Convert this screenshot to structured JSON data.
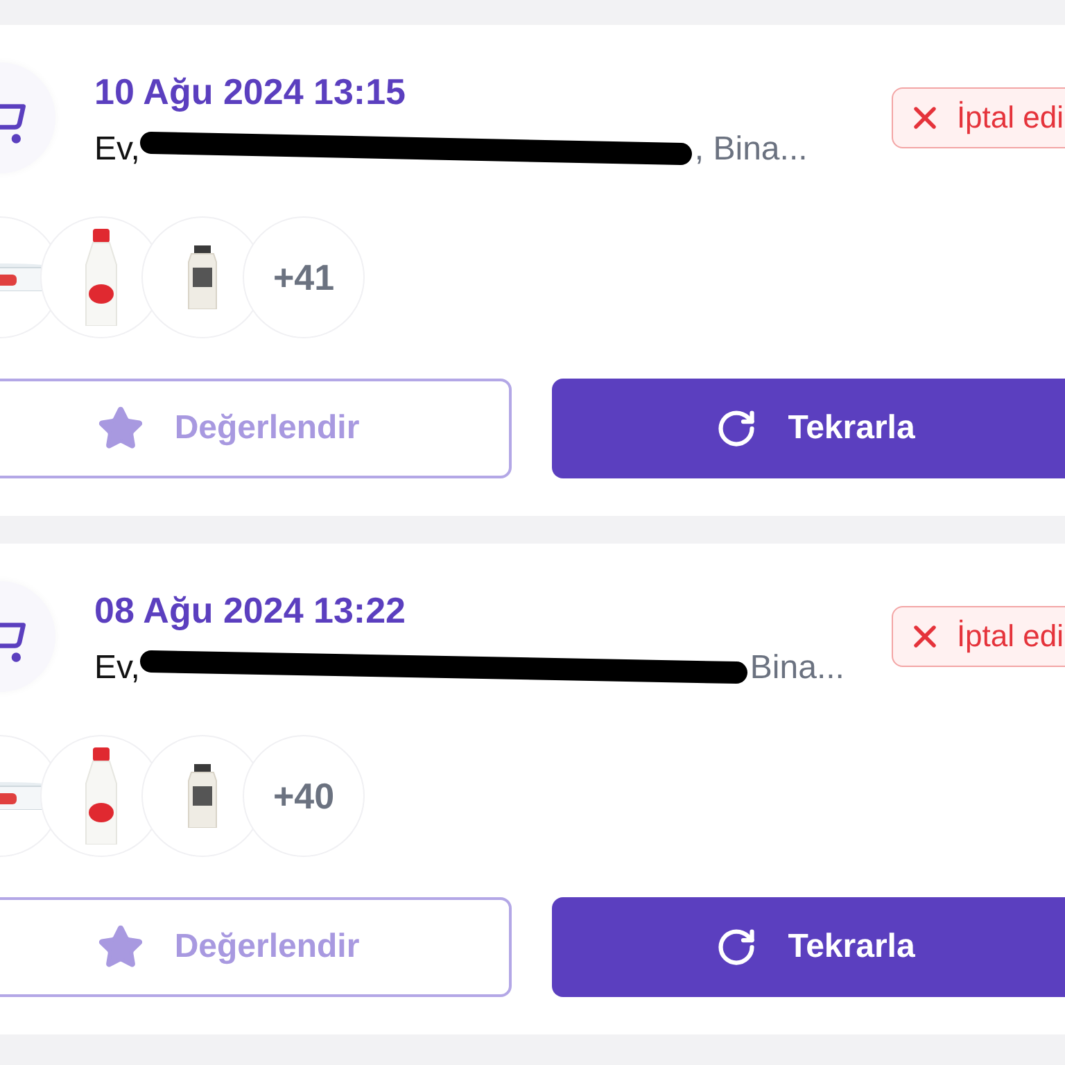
{
  "orders": [
    {
      "date": "10 Ağu 2024 13:15",
      "address_label": "Ev,",
      "address_tail": ", Bina...",
      "status": {
        "kind": "cancelled",
        "label": "İptal edi"
      },
      "products": [
        {
          "kind": "picture"
        },
        {
          "kind": "picture"
        },
        {
          "kind": "picture"
        }
      ],
      "more_count": "+41",
      "buttons": [
        {
          "kind": "rate",
          "label": "Değerlendir"
        },
        {
          "kind": "reorder",
          "label": "Tekrarla"
        }
      ]
    },
    {
      "date": "08 Ağu 2024 13:22",
      "address_label": "Ev,",
      "address_tail": "Bina...",
      "status": {
        "kind": "cancelled",
        "label": "İptal edi"
      },
      "products": [
        {
          "kind": "picture"
        },
        {
          "kind": "picture"
        },
        {
          "kind": "picture"
        }
      ],
      "more_count": "+40",
      "buttons": [
        {
          "kind": "rate",
          "label": "Değerlendir"
        },
        {
          "kind": "reorder",
          "label": "Tekrarla"
        }
      ]
    }
  ]
}
